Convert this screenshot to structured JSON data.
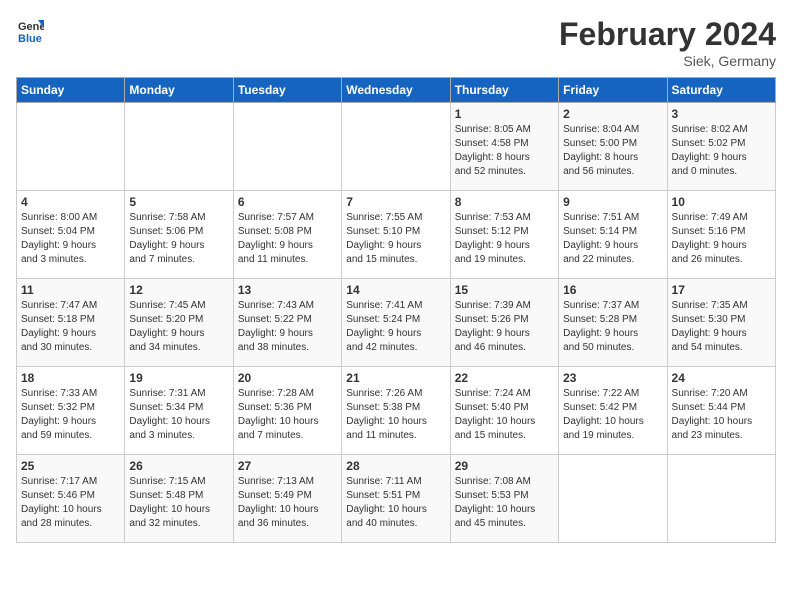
{
  "header": {
    "logo_line1": "General",
    "logo_line2": "Blue",
    "month_year": "February 2024",
    "location": "Siek, Germany"
  },
  "days_of_week": [
    "Sunday",
    "Monday",
    "Tuesday",
    "Wednesday",
    "Thursday",
    "Friday",
    "Saturday"
  ],
  "weeks": [
    [
      {
        "day": "",
        "info": ""
      },
      {
        "day": "",
        "info": ""
      },
      {
        "day": "",
        "info": ""
      },
      {
        "day": "",
        "info": ""
      },
      {
        "day": "1",
        "info": "Sunrise: 8:05 AM\nSunset: 4:58 PM\nDaylight: 8 hours\nand 52 minutes."
      },
      {
        "day": "2",
        "info": "Sunrise: 8:04 AM\nSunset: 5:00 PM\nDaylight: 8 hours\nand 56 minutes."
      },
      {
        "day": "3",
        "info": "Sunrise: 8:02 AM\nSunset: 5:02 PM\nDaylight: 9 hours\nand 0 minutes."
      }
    ],
    [
      {
        "day": "4",
        "info": "Sunrise: 8:00 AM\nSunset: 5:04 PM\nDaylight: 9 hours\nand 3 minutes."
      },
      {
        "day": "5",
        "info": "Sunrise: 7:58 AM\nSunset: 5:06 PM\nDaylight: 9 hours\nand 7 minutes."
      },
      {
        "day": "6",
        "info": "Sunrise: 7:57 AM\nSunset: 5:08 PM\nDaylight: 9 hours\nand 11 minutes."
      },
      {
        "day": "7",
        "info": "Sunrise: 7:55 AM\nSunset: 5:10 PM\nDaylight: 9 hours\nand 15 minutes."
      },
      {
        "day": "8",
        "info": "Sunrise: 7:53 AM\nSunset: 5:12 PM\nDaylight: 9 hours\nand 19 minutes."
      },
      {
        "day": "9",
        "info": "Sunrise: 7:51 AM\nSunset: 5:14 PM\nDaylight: 9 hours\nand 22 minutes."
      },
      {
        "day": "10",
        "info": "Sunrise: 7:49 AM\nSunset: 5:16 PM\nDaylight: 9 hours\nand 26 minutes."
      }
    ],
    [
      {
        "day": "11",
        "info": "Sunrise: 7:47 AM\nSunset: 5:18 PM\nDaylight: 9 hours\nand 30 minutes."
      },
      {
        "day": "12",
        "info": "Sunrise: 7:45 AM\nSunset: 5:20 PM\nDaylight: 9 hours\nand 34 minutes."
      },
      {
        "day": "13",
        "info": "Sunrise: 7:43 AM\nSunset: 5:22 PM\nDaylight: 9 hours\nand 38 minutes."
      },
      {
        "day": "14",
        "info": "Sunrise: 7:41 AM\nSunset: 5:24 PM\nDaylight: 9 hours\nand 42 minutes."
      },
      {
        "day": "15",
        "info": "Sunrise: 7:39 AM\nSunset: 5:26 PM\nDaylight: 9 hours\nand 46 minutes."
      },
      {
        "day": "16",
        "info": "Sunrise: 7:37 AM\nSunset: 5:28 PM\nDaylight: 9 hours\nand 50 minutes."
      },
      {
        "day": "17",
        "info": "Sunrise: 7:35 AM\nSunset: 5:30 PM\nDaylight: 9 hours\nand 54 minutes."
      }
    ],
    [
      {
        "day": "18",
        "info": "Sunrise: 7:33 AM\nSunset: 5:32 PM\nDaylight: 9 hours\nand 59 minutes."
      },
      {
        "day": "19",
        "info": "Sunrise: 7:31 AM\nSunset: 5:34 PM\nDaylight: 10 hours\nand 3 minutes."
      },
      {
        "day": "20",
        "info": "Sunrise: 7:28 AM\nSunset: 5:36 PM\nDaylight: 10 hours\nand 7 minutes."
      },
      {
        "day": "21",
        "info": "Sunrise: 7:26 AM\nSunset: 5:38 PM\nDaylight: 10 hours\nand 11 minutes."
      },
      {
        "day": "22",
        "info": "Sunrise: 7:24 AM\nSunset: 5:40 PM\nDaylight: 10 hours\nand 15 minutes."
      },
      {
        "day": "23",
        "info": "Sunrise: 7:22 AM\nSunset: 5:42 PM\nDaylight: 10 hours\nand 19 minutes."
      },
      {
        "day": "24",
        "info": "Sunrise: 7:20 AM\nSunset: 5:44 PM\nDaylight: 10 hours\nand 23 minutes."
      }
    ],
    [
      {
        "day": "25",
        "info": "Sunrise: 7:17 AM\nSunset: 5:46 PM\nDaylight: 10 hours\nand 28 minutes."
      },
      {
        "day": "26",
        "info": "Sunrise: 7:15 AM\nSunset: 5:48 PM\nDaylight: 10 hours\nand 32 minutes."
      },
      {
        "day": "27",
        "info": "Sunrise: 7:13 AM\nSunset: 5:49 PM\nDaylight: 10 hours\nand 36 minutes."
      },
      {
        "day": "28",
        "info": "Sunrise: 7:11 AM\nSunset: 5:51 PM\nDaylight: 10 hours\nand 40 minutes."
      },
      {
        "day": "29",
        "info": "Sunrise: 7:08 AM\nSunset: 5:53 PM\nDaylight: 10 hours\nand 45 minutes."
      },
      {
        "day": "",
        "info": ""
      },
      {
        "day": "",
        "info": ""
      }
    ]
  ]
}
